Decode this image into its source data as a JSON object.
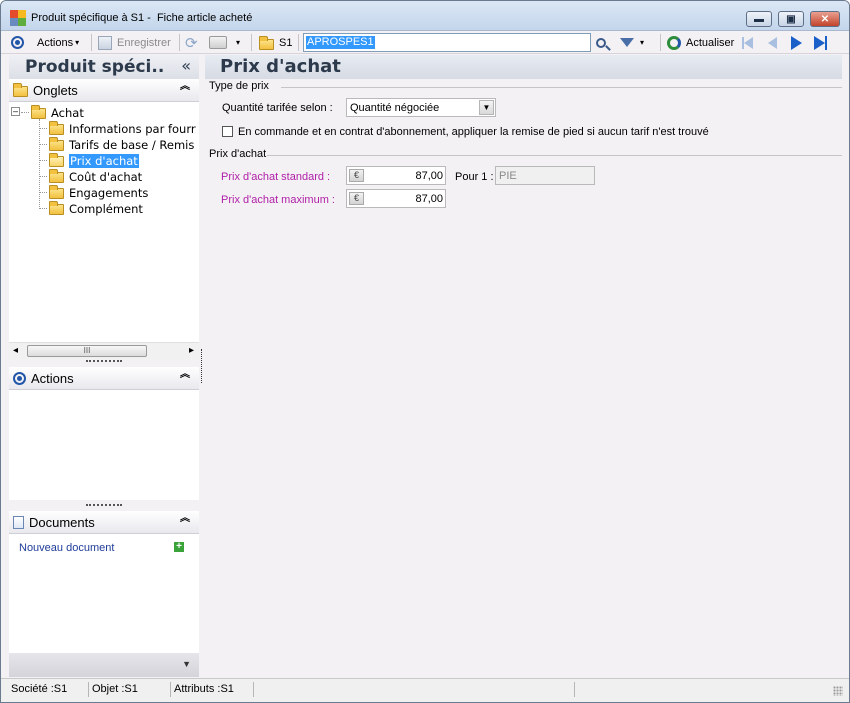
{
  "window": {
    "title": "Produit spécifique à S1 -  Fiche article acheté",
    "min_glyph": "▬",
    "max_glyph": "▣",
    "close_glyph": "✕"
  },
  "toolbar": {
    "actions_label": "Actions",
    "save_label": "Enregistrer",
    "site_label": "S1",
    "search_value": "APROSPES1",
    "refresh_label": "Actualiser",
    "caret": "▾"
  },
  "left_panel": {
    "header_title": "Produit spéci..",
    "collapse_glyph": "«",
    "tabs_panel": {
      "title": "Onglets",
      "root": "Achat",
      "items": [
        {
          "label": "Informations par fourr"
        },
        {
          "label": "Tarifs de base / Remis"
        },
        {
          "label": "Prix d'achat"
        },
        {
          "label": "Coût d'achat"
        },
        {
          "label": "Engagements"
        },
        {
          "label": "Complément"
        }
      ],
      "selected_index": 2,
      "scroll_left": "◂",
      "scroll_right": "▸",
      "thumb_grip": "III"
    },
    "actions_panel": {
      "title": "Actions"
    },
    "documents_panel": {
      "title": "Documents",
      "new_doc_label": "Nouveau document",
      "add_glyph": "+"
    },
    "chevron": "︽",
    "bottom_arrow": "▼"
  },
  "main": {
    "title": "Prix d'achat",
    "price_type_group": {
      "label": "Type de prix",
      "qty_label": "Quantité tarifée selon :",
      "qty_value": "Quantité négociée",
      "checkbox_label": "En commande et en contrat d'abonnement, appliquer la remise de pied si aucun tarif n'est trouvé",
      "checkbox_checked": false
    },
    "purchase_price_group": {
      "label": "Prix d'achat",
      "standard_label": "Prix d'achat standard :",
      "standard_value": "87,00",
      "max_label": "Prix d'achat maximum :",
      "max_value": "87,00",
      "per_label": "Pour 1 :",
      "unit_value": "PIE",
      "currency_glyph": "€"
    }
  },
  "statusbar": {
    "company": "Société :S1",
    "object": "Objet :S1",
    "attributes": "Attributs :S1"
  },
  "colors": {
    "label_magenta": "#b01fa8",
    "selection_blue": "#3399ff",
    "header_text": "#2c3a4c"
  }
}
